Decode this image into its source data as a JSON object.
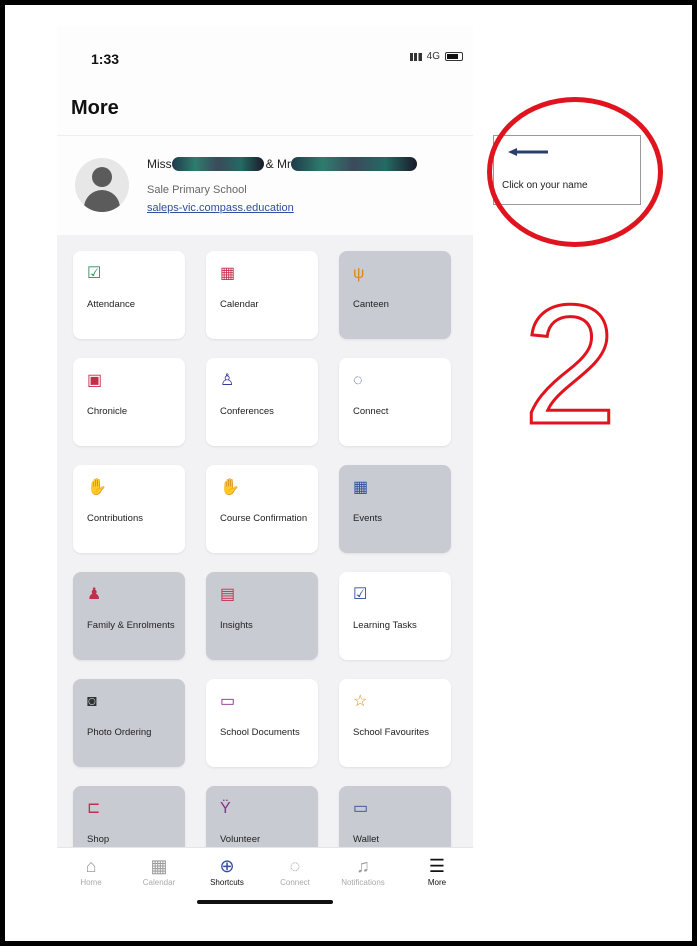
{
  "status_bar": {
    "time": "1:33",
    "network": "4G"
  },
  "page_title": "More",
  "profile": {
    "name_prefix": "Miss",
    "name_join": "& Mr",
    "school": "Sale Primary School",
    "link": "saleps-vic.compass.education"
  },
  "tiles": [
    {
      "label": "Attendance",
      "icon": "attendance-icon",
      "glyph": "☑",
      "color": "#2e8b57",
      "disabled": false
    },
    {
      "label": "Calendar",
      "icon": "calendar-icon",
      "glyph": "▦",
      "color": "#c0304a",
      "disabled": false
    },
    {
      "label": "Canteen",
      "icon": "cutlery-icon",
      "glyph": "ψ",
      "color": "#d98a1f",
      "disabled": true
    },
    {
      "label": "Chronicle",
      "icon": "chronicle-icon",
      "glyph": "▣",
      "color": "#c0304a",
      "disabled": false
    },
    {
      "label": "Conferences",
      "icon": "conferences-icon",
      "glyph": "♙",
      "color": "#3a3a9a",
      "disabled": false
    },
    {
      "label": "Connect",
      "icon": "chat-icon",
      "glyph": "◌",
      "color": "#2f4e9c",
      "disabled": false
    },
    {
      "label": "Contributions",
      "icon": "contributions-icon",
      "glyph": "✋",
      "color": "#2e8b57",
      "disabled": false
    },
    {
      "label": "Course Confirmation",
      "icon": "course-confirmation-icon",
      "glyph": "✋",
      "color": "#8a2f8a",
      "disabled": false
    },
    {
      "label": "Events",
      "icon": "events-icon",
      "glyph": "▦",
      "color": "#2f4e9c",
      "disabled": true
    },
    {
      "label": "Family & Enrolments",
      "icon": "family-icon",
      "glyph": "♟",
      "color": "#c0304a",
      "disabled": true
    },
    {
      "label": "Insights",
      "icon": "clipboard-icon",
      "glyph": "▤",
      "color": "#c0304a",
      "disabled": true
    },
    {
      "label": "Learning Tasks",
      "icon": "checkbox-icon",
      "glyph": "☑",
      "color": "#2f4e9c",
      "disabled": false
    },
    {
      "label": "Photo Ordering",
      "icon": "camera-icon",
      "glyph": "◙",
      "color": "#333333",
      "disabled": true
    },
    {
      "label": "School Documents",
      "icon": "folder-icon",
      "glyph": "▭",
      "color": "#8a2f8a",
      "disabled": false
    },
    {
      "label": "School Favourites",
      "icon": "star-icon",
      "glyph": "☆",
      "color": "#d98a1f",
      "disabled": false
    },
    {
      "label": "Shop",
      "icon": "cart-icon",
      "glyph": "⊏",
      "color": "#c0304a",
      "disabled": true
    },
    {
      "label": "Volunteer",
      "icon": "volunteer-icon",
      "glyph": "Ÿ",
      "color": "#8a2f8a",
      "disabled": true
    },
    {
      "label": "Wallet",
      "icon": "wallet-icon",
      "glyph": "▭",
      "color": "#2f4e9c",
      "disabled": true
    }
  ],
  "tab_bar": [
    {
      "label": "Home",
      "icon": "home-icon",
      "glyph": "⌂",
      "active": false
    },
    {
      "label": "Calendar",
      "icon": "calendar-icon",
      "glyph": "▦",
      "active": false
    },
    {
      "label": "Shortcuts",
      "icon": "plus-circle-icon",
      "glyph": "⊕",
      "active": true
    },
    {
      "label": "Connect",
      "icon": "chat-icon",
      "glyph": "◌",
      "active": false
    },
    {
      "label": "Notifications",
      "icon": "bell-icon",
      "glyph": "♫",
      "active": false
    },
    {
      "label": "More",
      "icon": "menu-icon",
      "glyph": "☰",
      "active": true
    }
  ],
  "annotation": {
    "callout_text": "Click on your name",
    "step_number": "2",
    "arrow_color": "#2a3f6b",
    "circle_color": "#e0141e"
  }
}
